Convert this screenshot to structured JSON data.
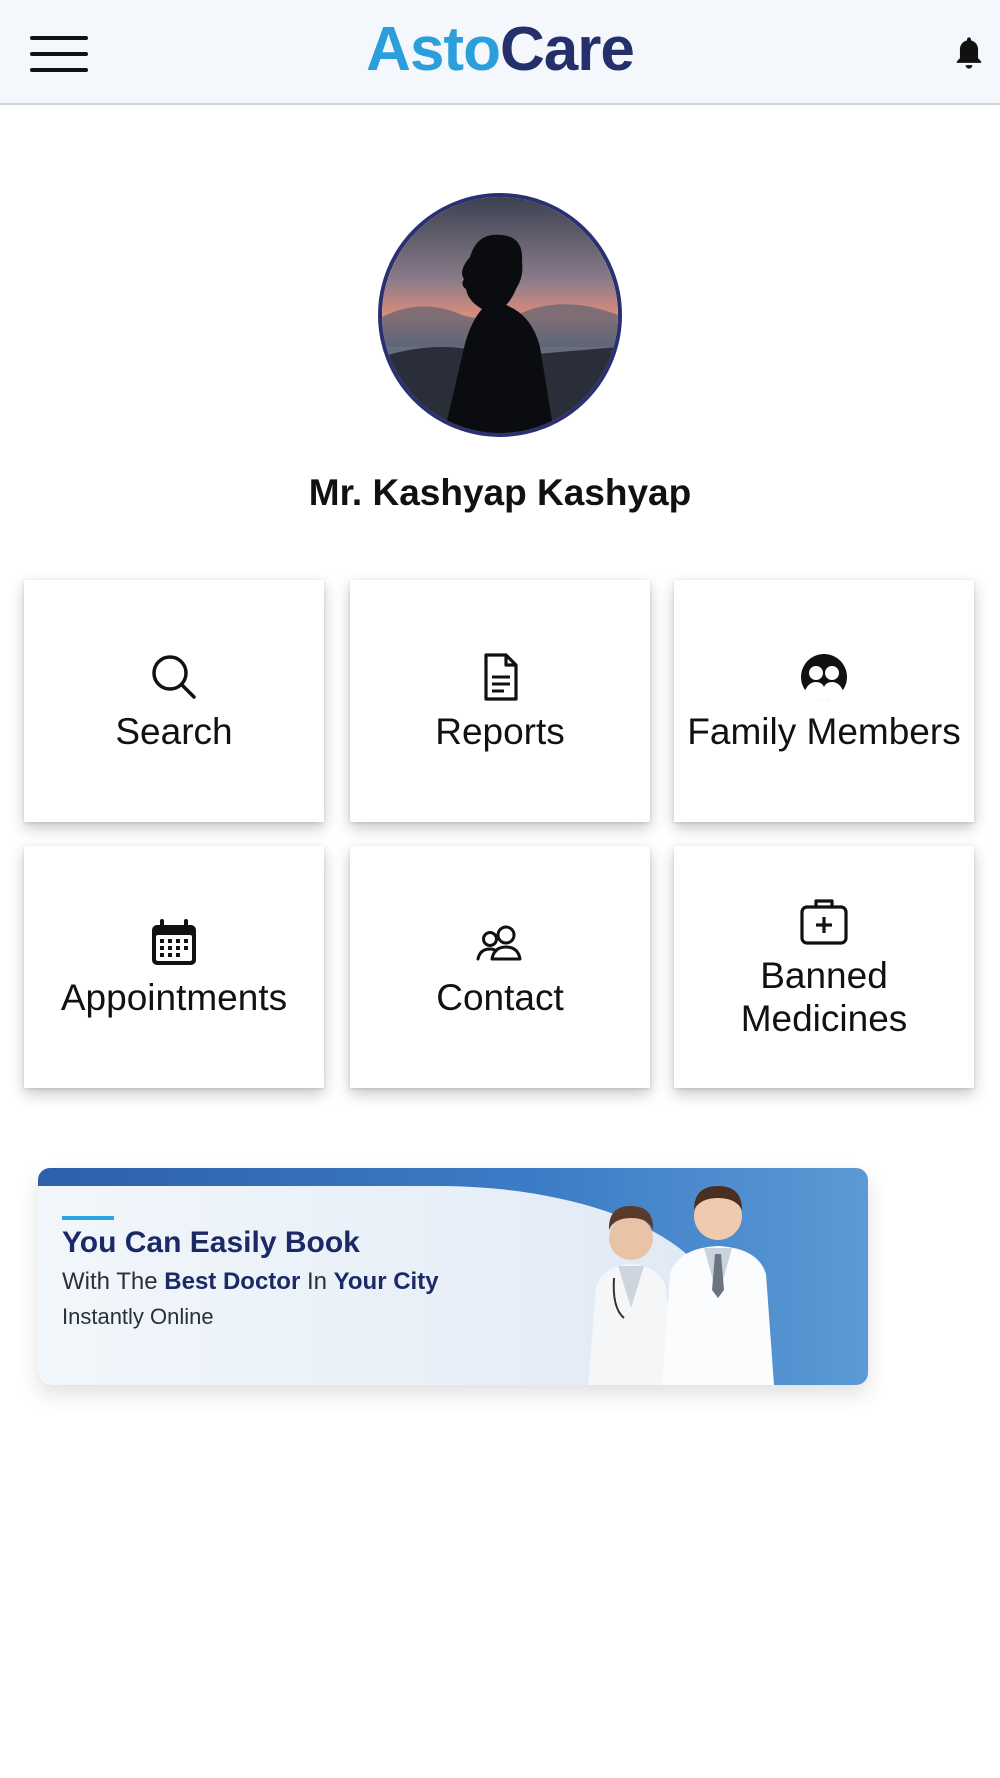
{
  "header": {
    "logo_part1": "Asto",
    "logo_part2": "Care",
    "menu_icon": "hamburger-menu-icon",
    "notification_icon": "bell-icon"
  },
  "profile": {
    "name": "Mr. Kashyap Kashyap"
  },
  "tiles": [
    {
      "label": "Search",
      "icon": "search-icon"
    },
    {
      "label": "Reports",
      "icon": "document-icon"
    },
    {
      "label": "Family Members",
      "icon": "family-icon"
    },
    {
      "label": "Appointments",
      "icon": "calendar-icon"
    },
    {
      "label": "Contact",
      "icon": "contacts-icon"
    },
    {
      "label": "Banned\nMedicines",
      "icon": "medical-kit-icon"
    }
  ],
  "banner": {
    "line1": "You Can Easily Book",
    "line2_a": "With The ",
    "line2_b": "Best Doctor",
    "line2_c": " In ",
    "line2_d": "Your City",
    "line3": "Instantly Online"
  },
  "colors": {
    "brand_light": "#2a9fdc",
    "brand_dark": "#23306b",
    "header_bg": "#f4f7fb",
    "banner_blue": "#3c7cc6"
  }
}
